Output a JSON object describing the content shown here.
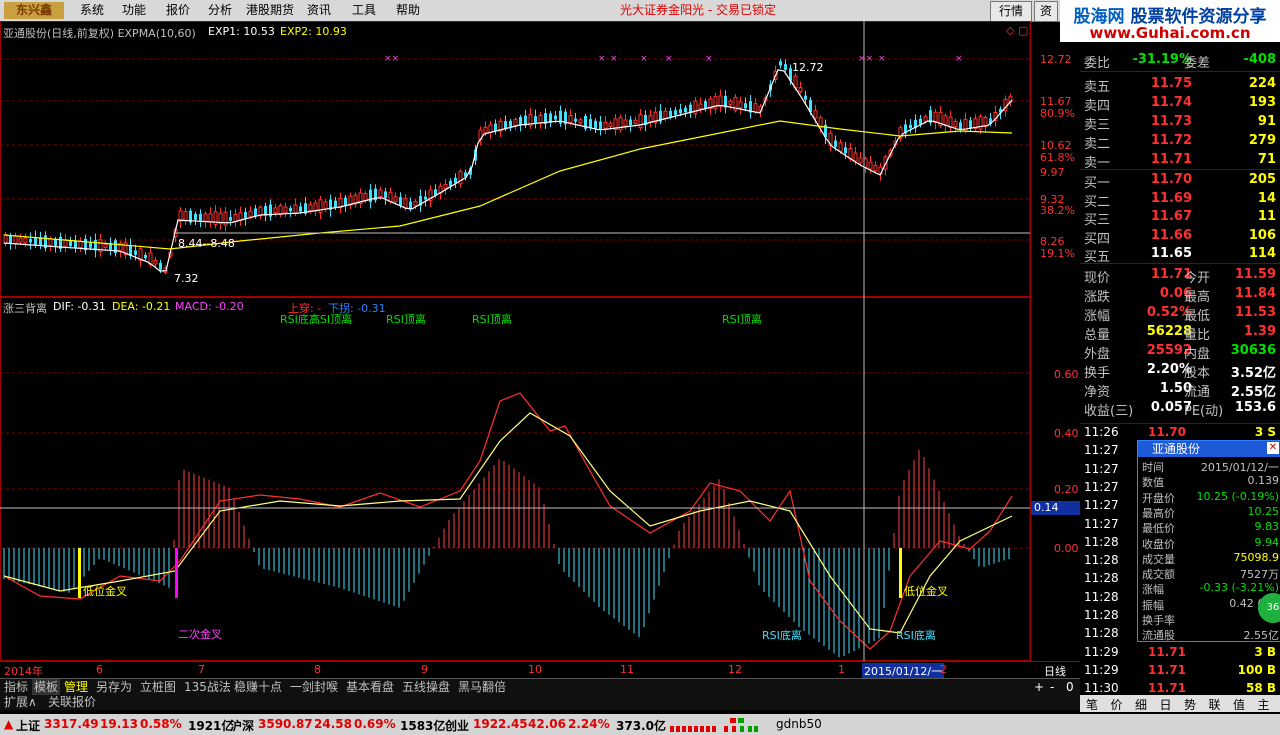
{
  "topbar": {
    "logo": "东兴鑫",
    "menu": [
      "系统",
      "功能",
      "报价",
      "分析",
      "港股期货",
      "资讯",
      "工具",
      "帮助"
    ],
    "marquee": "光大证券金阳光 - 交易已锁定",
    "buttons": [
      "行情",
      "资"
    ],
    "ad_line1_a": "股海网",
    "ad_line1_b": "股票软件资源分享",
    "ad_line2": "www.Guhai.com.cn"
  },
  "price_panel": {
    "title": "亚通股份(日线,前复权) EXPMA(10,60)",
    "exp1_label": "EXP1: 10.53",
    "exp2_label": "EXP2: 10.93",
    "axis": [
      "12.72",
      "11.67",
      "80.9%",
      "10.62",
      "61.8%",
      "9.97",
      "9.32",
      "38.2%",
      "8.26",
      "19.1%"
    ],
    "high_label": "12.72",
    "low_label": "7.32",
    "mid_label": "8.44--8.48"
  },
  "macd_panel": {
    "title": "涨三背离",
    "dif": "DIF: -0.31",
    "dea": "DEA: -0.21",
    "macd": "MACD: -0.20",
    "extra": "上穿: -",
    "extra2": "下拐: -0.31",
    "axis": [
      "0.60",
      "0.40",
      "0.20",
      "0.00"
    ],
    "cursor_value": "0.14",
    "labels": {
      "l1": "RSI底高SI顶离",
      "l2": "RSI顶离",
      "l3": "RSI顶离",
      "l4": "RSI顶离",
      "gold1": "低位金叉",
      "gold2": "二次金叉",
      "rsi1": "RSI底离",
      "rsi2": "RSI底离",
      "gold3": "低位金叉"
    }
  },
  "xaxis": {
    "labels": [
      "2014年",
      "6",
      "7",
      "8",
      "9",
      "10",
      "11",
      "12",
      "1",
      "2015/01/12/一",
      "2"
    ],
    "period": "日线"
  },
  "tabs": [
    "指标",
    "模板",
    "管理",
    "另存为",
    "立桩图",
    "135战法",
    "稳赚十点",
    "一剑封喉",
    "基本看盘",
    "五线操盘",
    "黑马翻倍"
  ],
  "tabs2": [
    "扩展∧",
    "关联报价"
  ],
  "quote": {
    "ratio": {
      "label": "委比",
      "value": "-31.19%",
      "label2": "委差",
      "value2": "-408"
    },
    "sell": [
      {
        "l": "卖五",
        "p": "11.75",
        "v": "224"
      },
      {
        "l": "卖四",
        "p": "11.74",
        "v": "193"
      },
      {
        "l": "卖三",
        "p": "11.73",
        "v": "91"
      },
      {
        "l": "卖二",
        "p": "11.72",
        "v": "279"
      },
      {
        "l": "卖一",
        "p": "11.71",
        "v": "71"
      }
    ],
    "buy": [
      {
        "l": "买一",
        "p": "11.70",
        "v": "205"
      },
      {
        "l": "买二",
        "p": "11.69",
        "v": "14"
      },
      {
        "l": "买三",
        "p": "11.67",
        "v": "11"
      },
      {
        "l": "买四",
        "p": "11.66",
        "v": "106"
      },
      {
        "l": "买五",
        "p": "11.65",
        "v": "114"
      }
    ],
    "stats": [
      {
        "l": "现价",
        "v": "11.71",
        "l2": "今开",
        "v2": "11.59",
        "c": "#ff3030",
        "c2": "#ff3030"
      },
      {
        "l": "涨跌",
        "v": "0.06",
        "l2": "最高",
        "v2": "11.84",
        "c": "#ff3030",
        "c2": "#ff3030"
      },
      {
        "l": "涨幅",
        "v": "0.52%",
        "l2": "最低",
        "v2": "11.53",
        "c": "#ff3030",
        "c2": "#ff3030"
      },
      {
        "l": "总量",
        "v": "56228",
        "l2": "量比",
        "v2": "1.39",
        "c": "#ffff00",
        "c2": "#ff3030"
      },
      {
        "l": "外盘",
        "v": "25592",
        "l2": "内盘",
        "v2": "30636",
        "c": "#ff3030",
        "c2": "#00e000"
      },
      {
        "l": "换手",
        "v": "2.20%",
        "l2": "股本",
        "v2": "3.52亿",
        "c": "#ffffff",
        "c2": "#ffffff"
      },
      {
        "l": "净资",
        "v": "1.50",
        "l2": "流通",
        "v2": "2.55亿",
        "c": "#ffffff",
        "c2": "#ffffff"
      },
      {
        "l": "收益(三)",
        "v": "0.057",
        "l2": "PE(动)",
        "v2": "153.6",
        "c": "#ffffff",
        "c2": "#ffffff"
      }
    ],
    "ticks": [
      {
        "t": "11:26",
        "p": "11.70",
        "v": "3 S"
      },
      {
        "t": "11:27",
        "p": "",
        "v": ""
      },
      {
        "t": "11:27",
        "p": "",
        "v": ""
      },
      {
        "t": "11:27",
        "p": "",
        "v": ""
      },
      {
        "t": "11:27",
        "p": "",
        "v": ""
      },
      {
        "t": "11:27",
        "p": "",
        "v": ""
      },
      {
        "t": "11:28",
        "p": "",
        "v": ""
      },
      {
        "t": "11:28",
        "p": "",
        "v": ""
      },
      {
        "t": "11:28",
        "p": "",
        "v": ""
      },
      {
        "t": "11:28",
        "p": "",
        "v": ""
      },
      {
        "t": "11:28",
        "p": "",
        "v": ""
      },
      {
        "t": "11:28",
        "p": "",
        "v": ""
      },
      {
        "t": "11:29",
        "p": "11.71",
        "v": "3 B"
      },
      {
        "t": "11:29",
        "p": "11.71",
        "v": "100 B"
      },
      {
        "t": "11:30",
        "p": "11.71",
        "v": "58 B"
      }
    ]
  },
  "popup": {
    "title": "亚通股份",
    "rows": [
      {
        "l": "时间",
        "v": "2015/01/12/一",
        "c": "#c0c0c0"
      },
      {
        "l": "数值",
        "v": "0.139",
        "c": "#c0c0c0"
      },
      {
        "l": "开盘价",
        "v": "10.25 (-0.19%)",
        "c": "#00e000"
      },
      {
        "l": "最高价",
        "v": "10.25",
        "c": "#00e000"
      },
      {
        "l": "最低价",
        "v": "9.83",
        "c": "#00e000"
      },
      {
        "l": "收盘价",
        "v": "9.94",
        "c": "#00e000"
      },
      {
        "l": "成交量",
        "v": "75098.9",
        "c": "#ffff00"
      },
      {
        "l": "成交额",
        "v": "7527万",
        "c": "#c0c0c0"
      },
      {
        "l": "涨幅",
        "v": "-0.33 (-3.21%)",
        "c": "#00e000"
      },
      {
        "l": "振幅",
        "v": "0.42 (4.0",
        "c": "#c0c0c0"
      },
      {
        "l": "换手率",
        "v": "2.",
        "c": "#c0c0c0"
      },
      {
        "l": "流通股",
        "v": "2.55亿",
        "c": "#c0c0c0"
      }
    ]
  },
  "rtabs": [
    "笔",
    "价",
    "细",
    "日",
    "势",
    "联",
    "值",
    "主"
  ],
  "status": {
    "sh": {
      "l": "上证",
      "v": "3317.49",
      "c": "19.13",
      "p": "0.58%",
      "a": "1921亿"
    },
    "sz": {
      "l": "沪深",
      "v": "3590.87",
      "c": "24.58",
      "p": "0.69%",
      "a": "1583亿"
    },
    "cy": {
      "l": "创业",
      "v": "1922.45",
      "c": "42.06",
      "p": "2.24%",
      "a": "373.0亿"
    },
    "server": "gdnb50"
  }
}
